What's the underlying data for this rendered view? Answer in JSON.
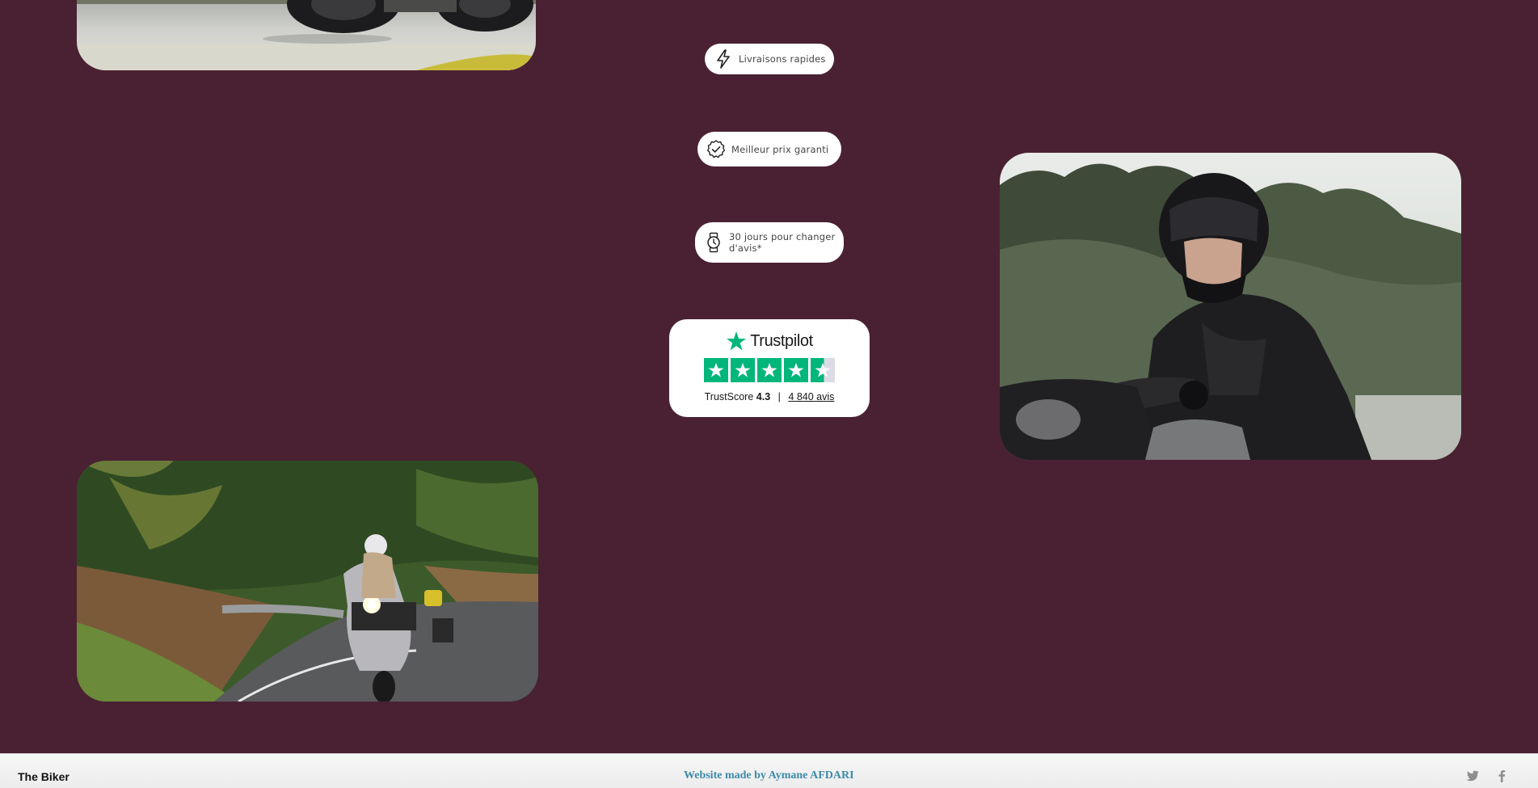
{
  "features": [
    {
      "label": "Livraisons rapides",
      "icon": "lightning-icon"
    },
    {
      "label": "Meilleur prix garanti",
      "icon": "badge-check-icon"
    },
    {
      "label": "30 jours pour changer d'avis*",
      "icon": "watch-icon"
    }
  ],
  "trustpilot": {
    "brand": "Trustpilot",
    "score_label": "TrustScore",
    "score": "4.3",
    "separator": "|",
    "reviews": "4 840 avis",
    "stars_filled": 4.5,
    "star_color": "#00b67a"
  },
  "footer": {
    "brand": "The Biker",
    "credit": "Website made by Aymane AFDARI",
    "social": [
      "twitter-icon",
      "facebook-icon"
    ]
  },
  "colors": {
    "background": "#4a2133",
    "footer_credit": "#3c8ba8"
  }
}
